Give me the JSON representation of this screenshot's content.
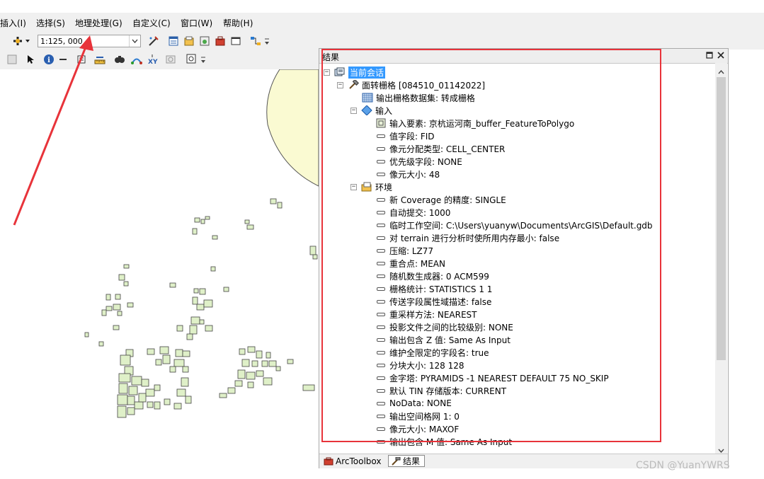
{
  "menu": {
    "items": [
      "插入(I)",
      "选择(S)",
      "地理处理(G)",
      "自定义(C)",
      "窗口(W)",
      "帮助(H)"
    ]
  },
  "toolbar": {
    "scale_value": "1:125, 000"
  },
  "results_panel": {
    "title": "结果",
    "session_label": "当前会话",
    "tool_label": "面转栅格 [084510_01142022]",
    "output_label": "输出栅格数据集: 转成栅格",
    "inputs_group": "输入",
    "inputs": [
      "输入要素: 京杭运河南_buffer_FeatureToPolygo",
      "值字段: FID",
      "像元分配类型: CELL_CENTER",
      "优先级字段: NONE",
      "像元大小: 48"
    ],
    "env_group": "环境",
    "env": [
      "新 Coverage 的精度: SINGLE",
      "自动提交: 1000",
      "临时工作空间: C:\\Users\\yuanyw\\Documents\\ArcGIS\\Default.gdb",
      "对 terrain 进行分析时使所用内存最小: false",
      "压缩: LZ77",
      "重合点: MEAN",
      "随机数生成器: 0 ACM599",
      "栅格统计: STATISTICS 1 1",
      "传送字段属性域描述: false",
      "重采样方法: NEAREST",
      "投影文件之间的比较级别: NONE",
      "输出包含 Z 值: Same As Input",
      "维护全限定的字段名: true",
      "分块大小: 128 128",
      "金字塔: PYRAMIDS -1 NEAREST DEFAULT 75 NO_SKIP",
      "默认 TIN 存储版本: CURRENT",
      "NoData: NONE",
      "输出空间格网 1: 0",
      "像元大小: MAXOF",
      "输出包含 M 值: Same As Input"
    ],
    "tabs": [
      "ArcToolbox",
      "结果"
    ]
  },
  "watermark": "CSDN @YuanYWRS",
  "colors": {
    "annotation_red": "#e8333a",
    "selection_blue": "#3399ff",
    "parcel_green": "#dff0c8",
    "buffer_yellow": "#fafad2"
  }
}
